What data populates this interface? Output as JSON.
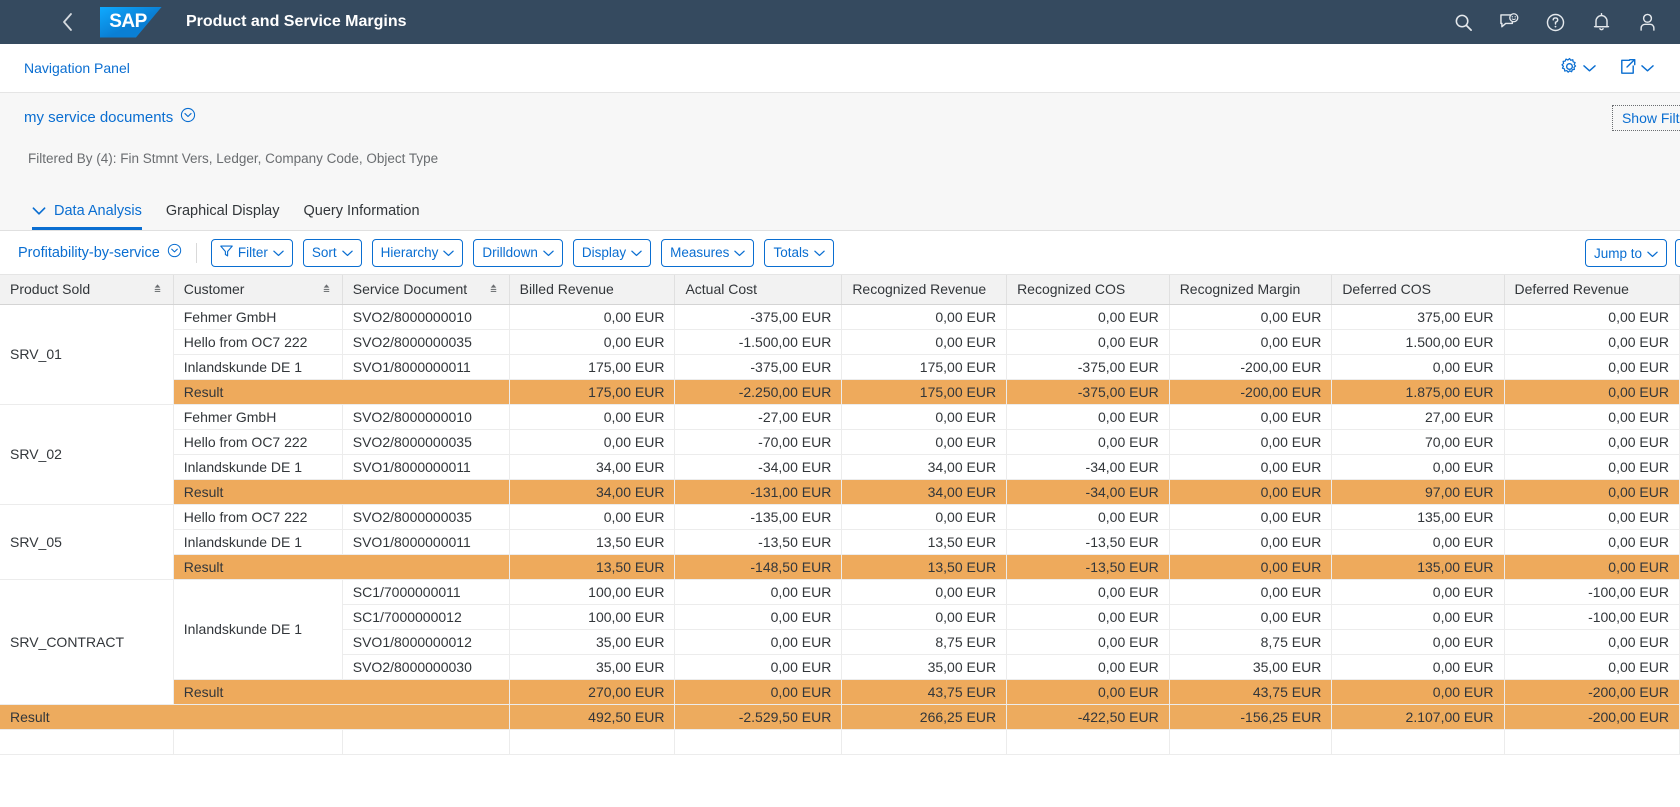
{
  "header": {
    "back_label": "Back",
    "logo_text": "SAP",
    "title": "Product and Service Margins",
    "icons": [
      {
        "name": "search-icon",
        "label": "Search"
      },
      {
        "name": "feedback-icon",
        "label": "Feedback"
      },
      {
        "name": "help-icon",
        "label": "Help"
      },
      {
        "name": "notification-bell-icon",
        "label": "Notifications"
      },
      {
        "name": "user-avatar-icon",
        "label": "User"
      }
    ]
  },
  "nav_panel": {
    "label": "Navigation Panel",
    "settings_label": "",
    "share_label": ""
  },
  "variant": {
    "name": "my service documents",
    "filtered_by": "Filtered By (4): Fin Stmnt Vers, Ledger, Company Code, Object Type",
    "show_filter_label": "Show Filter"
  },
  "tabs": [
    {
      "label": "Data Analysis",
      "active": true
    },
    {
      "label": "Graphical Display",
      "active": false
    },
    {
      "label": "Query Information",
      "active": false
    }
  ],
  "toolbar": {
    "query_name": "Profitability-by-service",
    "buttons": [
      {
        "label": "Filter",
        "icon": "filter-icon"
      },
      {
        "label": "Sort",
        "icon": ""
      },
      {
        "label": "Hierarchy",
        "icon": ""
      },
      {
        "label": "Drilldown",
        "icon": ""
      },
      {
        "label": "Display",
        "icon": ""
      },
      {
        "label": "Measures",
        "icon": ""
      },
      {
        "label": "Totals",
        "icon": ""
      }
    ],
    "jump_to_label": "Jump to"
  },
  "table": {
    "columns": [
      {
        "label": "Product Sold",
        "sortable": true,
        "numeric": false
      },
      {
        "label": "Customer",
        "sortable": true,
        "numeric": false
      },
      {
        "label": "Service Document",
        "sortable": true,
        "numeric": false
      },
      {
        "label": "Billed Revenue",
        "sortable": false,
        "numeric": true
      },
      {
        "label": "Actual Cost",
        "sortable": false,
        "numeric": true
      },
      {
        "label": "Recognized Revenue",
        "sortable": false,
        "numeric": true
      },
      {
        "label": "Recognized COS",
        "sortable": false,
        "numeric": true
      },
      {
        "label": "Recognized Margin",
        "sortable": false,
        "numeric": true
      },
      {
        "label": "Deferred COS",
        "sortable": false,
        "numeric": true
      },
      {
        "label": "Deferred Revenue",
        "sortable": false,
        "numeric": true
      }
    ],
    "result_label": "Result",
    "groups": [
      {
        "product": "SRV_01",
        "rows": [
          {
            "customer": "Fehmer GmbH",
            "doc": "SVO2/8000000010",
            "values": [
              "0,00 EUR",
              "-375,00 EUR",
              "0,00 EUR",
              "0,00 EUR",
              "0,00 EUR",
              "375,00 EUR",
              "0,00 EUR"
            ]
          },
          {
            "customer": "Hello from OC7 222",
            "doc": "SVO2/8000000035",
            "values": [
              "0,00 EUR",
              "-1.500,00 EUR",
              "0,00 EUR",
              "0,00 EUR",
              "0,00 EUR",
              "1.500,00 EUR",
              "0,00 EUR"
            ]
          },
          {
            "customer": "Inlandskunde DE 1",
            "doc": "SVO1/8000000011",
            "values": [
              "175,00 EUR",
              "-375,00 EUR",
              "175,00 EUR",
              "-375,00 EUR",
              "-200,00 EUR",
              "0,00 EUR",
              "0,00 EUR"
            ]
          }
        ],
        "result": [
          "175,00 EUR",
          "-2.250,00 EUR",
          "175,00 EUR",
          "-375,00 EUR",
          "-200,00 EUR",
          "1.875,00 EUR",
          "0,00 EUR"
        ]
      },
      {
        "product": "SRV_02",
        "rows": [
          {
            "customer": "Fehmer GmbH",
            "doc": "SVO2/8000000010",
            "values": [
              "0,00 EUR",
              "-27,00 EUR",
              "0,00 EUR",
              "0,00 EUR",
              "0,00 EUR",
              "27,00 EUR",
              "0,00 EUR"
            ]
          },
          {
            "customer": "Hello from OC7 222",
            "doc": "SVO2/8000000035",
            "values": [
              "0,00 EUR",
              "-70,00 EUR",
              "0,00 EUR",
              "0,00 EUR",
              "0,00 EUR",
              "70,00 EUR",
              "0,00 EUR"
            ]
          },
          {
            "customer": "Inlandskunde DE 1",
            "doc": "SVO1/8000000011",
            "values": [
              "34,00 EUR",
              "-34,00 EUR",
              "34,00 EUR",
              "-34,00 EUR",
              "0,00 EUR",
              "0,00 EUR",
              "0,00 EUR"
            ]
          }
        ],
        "result": [
          "34,00 EUR",
          "-131,00 EUR",
          "34,00 EUR",
          "-34,00 EUR",
          "0,00 EUR",
          "97,00 EUR",
          "0,00 EUR"
        ]
      },
      {
        "product": "SRV_05",
        "rows": [
          {
            "customer": "Hello from OC7 222",
            "doc": "SVO2/8000000035",
            "values": [
              "0,00 EUR",
              "-135,00 EUR",
              "0,00 EUR",
              "0,00 EUR",
              "0,00 EUR",
              "135,00 EUR",
              "0,00 EUR"
            ]
          },
          {
            "customer": "Inlandskunde DE 1",
            "doc": "SVO1/8000000011",
            "values": [
              "13,50 EUR",
              "-13,50 EUR",
              "13,50 EUR",
              "-13,50 EUR",
              "0,00 EUR",
              "0,00 EUR",
              "0,00 EUR"
            ]
          }
        ],
        "result": [
          "13,50 EUR",
          "-148,50 EUR",
          "13,50 EUR",
          "-13,50 EUR",
          "0,00 EUR",
          "135,00 EUR",
          "0,00 EUR"
        ]
      },
      {
        "product": "SRV_CONTRACT",
        "merged_customer": "Inlandskunde DE 1",
        "rows": [
          {
            "customer": "",
            "doc": "SC1/7000000011",
            "values": [
              "100,00 EUR",
              "0,00 EUR",
              "0,00 EUR",
              "0,00 EUR",
              "0,00 EUR",
              "0,00 EUR",
              "-100,00 EUR"
            ]
          },
          {
            "customer": "",
            "doc": "SC1/7000000012",
            "values": [
              "100,00 EUR",
              "0,00 EUR",
              "0,00 EUR",
              "0,00 EUR",
              "0,00 EUR",
              "0,00 EUR",
              "-100,00 EUR"
            ]
          },
          {
            "customer": "",
            "doc": "SVO1/8000000012",
            "values": [
              "35,00 EUR",
              "0,00 EUR",
              "8,75 EUR",
              "0,00 EUR",
              "8,75 EUR",
              "0,00 EUR",
              "0,00 EUR"
            ]
          },
          {
            "customer": "",
            "doc": "SVO2/8000000030",
            "values": [
              "35,00 EUR",
              "0,00 EUR",
              "35,00 EUR",
              "0,00 EUR",
              "35,00 EUR",
              "0,00 EUR",
              "0,00 EUR"
            ]
          }
        ],
        "result": [
          "270,00 EUR",
          "0,00 EUR",
          "43,75 EUR",
          "0,00 EUR",
          "43,75 EUR",
          "0,00 EUR",
          "-200,00 EUR"
        ]
      }
    ],
    "grand_total": {
      "label": "Result",
      "values": [
        "492,50 EUR",
        "-2.529,50 EUR",
        "266,25 EUR",
        "-422,50 EUR",
        "-156,25 EUR",
        "2.107,00 EUR",
        "-200,00 EUR"
      ]
    }
  }
}
